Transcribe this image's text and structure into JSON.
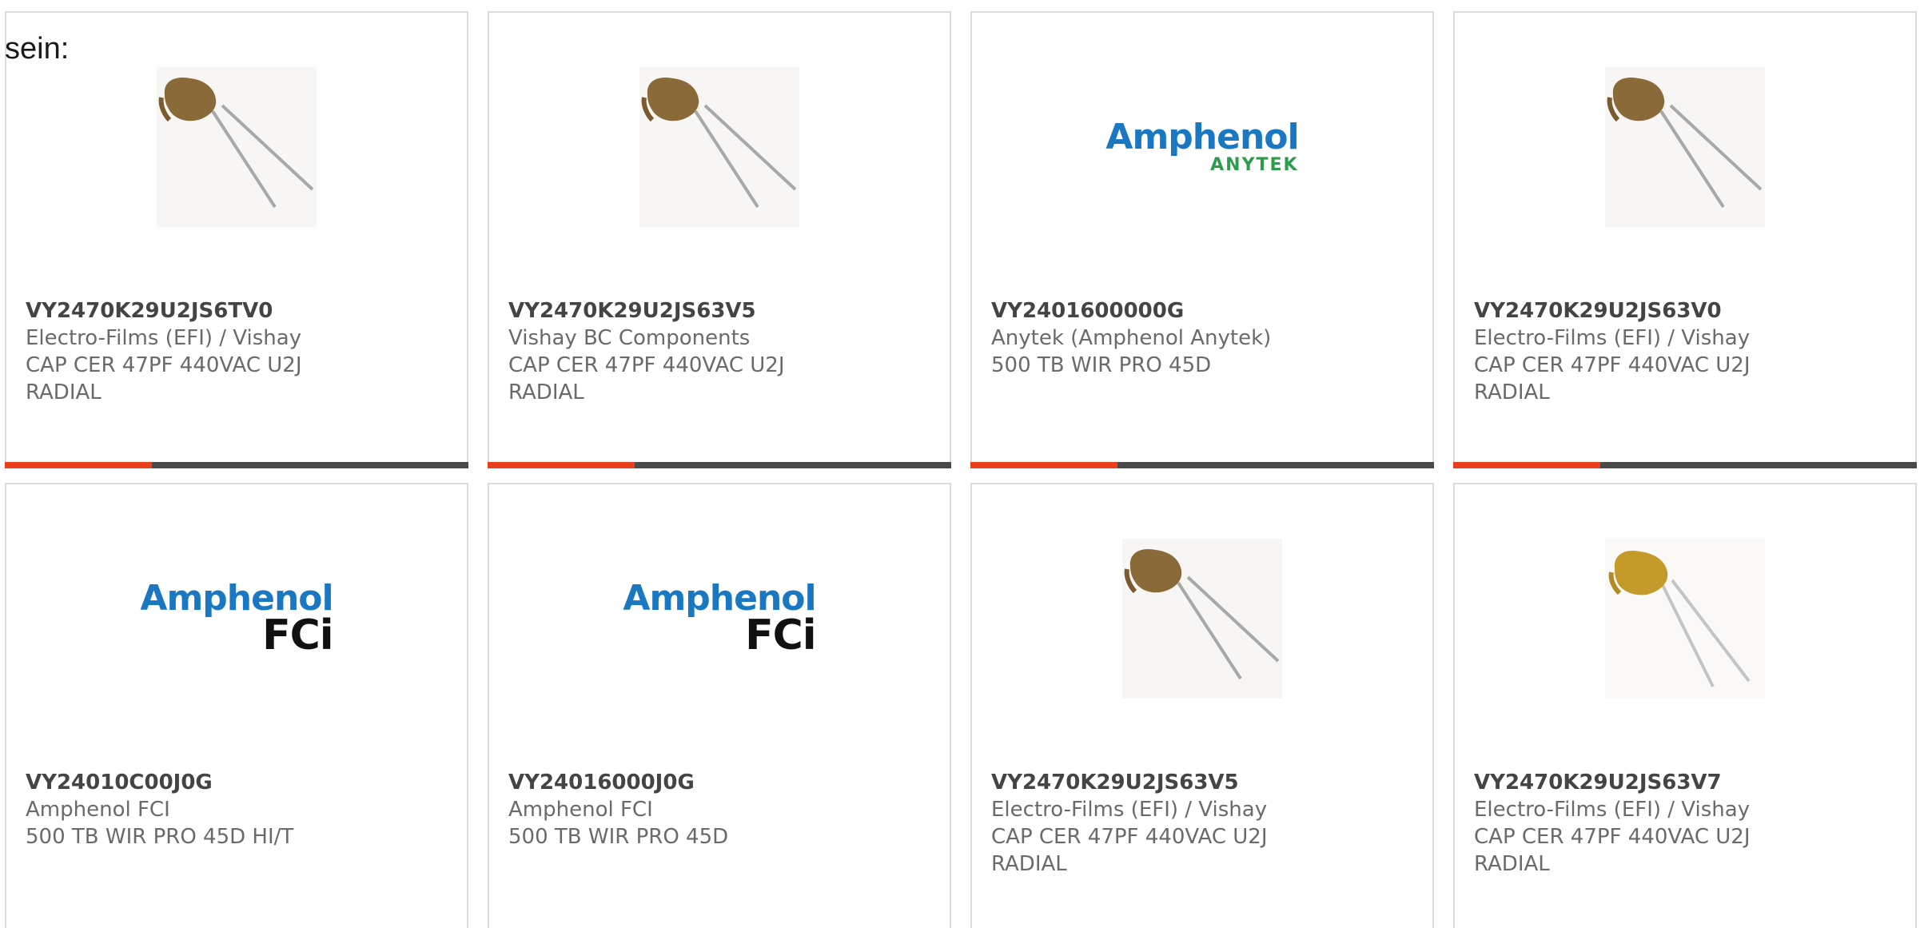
{
  "intro_text": "sein:",
  "colors": {
    "accent": "#e8401c",
    "bar": "#4a4a4a",
    "border": "#dcdcdc",
    "amphenol_blue": "#1a78c2",
    "anytek_green": "#2e9d4b"
  },
  "products": [
    {
      "part": "VY2470K29U2JS6TV0",
      "manufacturer": "Electro-Films (EFI) / Vishay",
      "desc1": "CAP CER 47PF 440VAC U2J",
      "desc2": "RADIAL",
      "image": "capacitor-image"
    },
    {
      "part": "VY2470K29U2JS63V5",
      "manufacturer": "Vishay BC Components",
      "desc1": "CAP CER 47PF 440VAC U2J",
      "desc2": "RADIAL",
      "image": "capacitor-image"
    },
    {
      "part": "VY2401600000G",
      "manufacturer": "Anytek (Amphenol Anytek)",
      "desc1": "500 TB WIR PRO 45D",
      "desc2": "",
      "image": "amphenol-anytek-logo",
      "logo_main": "Amphenol",
      "logo_sub": "ANYTEK"
    },
    {
      "part": "VY2470K29U2JS63V0",
      "manufacturer": "Electro-Films (EFI) / Vishay",
      "desc1": "CAP CER 47PF 440VAC U2J",
      "desc2": "RADIAL",
      "image": "capacitor-image"
    },
    {
      "part": "VY24010C00J0G",
      "manufacturer": "Amphenol FCI",
      "desc1": "500 TB WIR PRO 45D HI/T",
      "desc2": "",
      "image": "amphenol-fci-logo",
      "logo_main": "Amphenol",
      "logo_sub": "FCi"
    },
    {
      "part": "VY24016000J0G",
      "manufacturer": "Amphenol FCI",
      "desc1": "500 TB WIR PRO 45D",
      "desc2": "",
      "image": "amphenol-fci-logo",
      "logo_main": "Amphenol",
      "logo_sub": "FCi"
    },
    {
      "part": "VY2470K29U2JS63V5",
      "manufacturer": "Electro-Films (EFI) / Vishay",
      "desc1": "CAP CER 47PF 440VAC U2J",
      "desc2": "RADIAL",
      "image": "capacitor-image"
    },
    {
      "part": "VY2470K29U2JS63V7",
      "manufacturer": "Electro-Films (EFI) / Vishay",
      "desc1": "CAP CER 47PF 440VAC U2J",
      "desc2": "RADIAL",
      "image": "capacitor-image-light"
    }
  ]
}
